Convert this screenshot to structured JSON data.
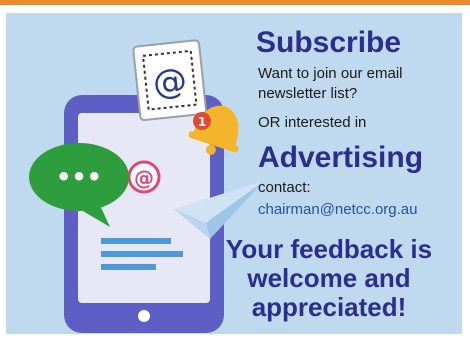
{
  "promo": {
    "subscribe_heading": "Subscribe",
    "subscribe_line1": "Want to join our email",
    "subscribe_line2": "newsletter list?",
    "or_line": "OR interested in",
    "advertising_heading": "Advertising",
    "contact_label": "contact:",
    "email": "chairman@netcc.org.au",
    "feedback_line1": "Your feedback is",
    "feedback_line2": "welcome and",
    "feedback_line3": "appreciated!",
    "icon_at_symbol": "@",
    "bell_badge": "1",
    "chat_dots": "•••"
  },
  "colors": {
    "accent_orange": "#e98a2c",
    "background": "#bfd9ee",
    "heading_blue": "#2a2f8f",
    "phone_purple": "#5e5fc4",
    "chat_green": "#2e9d3d",
    "pink_accent": "#e04677",
    "email_blue": "#2750a8"
  }
}
